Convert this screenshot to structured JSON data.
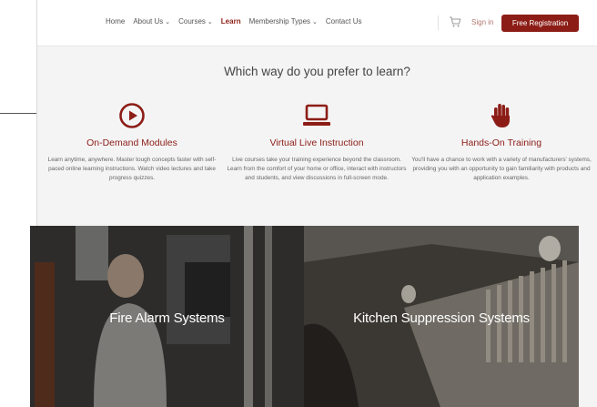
{
  "nav": {
    "links": [
      {
        "label": "Home",
        "has_dropdown": false,
        "active": false
      },
      {
        "label": "About Us",
        "has_dropdown": true,
        "active": false
      },
      {
        "label": "Courses",
        "has_dropdown": true,
        "active": false
      },
      {
        "label": "Learn",
        "has_dropdown": false,
        "active": true
      },
      {
        "label": "Membership Types",
        "has_dropdown": true,
        "active": false
      },
      {
        "label": "Contact Us",
        "has_dropdown": false,
        "active": false
      }
    ],
    "signin_label": "Sign in",
    "register_label": "Free Registration",
    "cart_icon": "cart-icon"
  },
  "main": {
    "heading": "Which way do you prefer to learn?",
    "options": [
      {
        "icon": "play-circle-icon",
        "title": "On-Demand Modules",
        "description": "Learn anytime, anywhere. Master tough concepts faster with self-paced online learning instructions. Watch video lectures and take progress quizzes."
      },
      {
        "icon": "laptop-icon",
        "title": "Virtual Live Instruction",
        "description": "Live courses take your training experience beyond the classroom. Learn from the comfort of your home or office, interact with instructors and students, and view discussions in full-screen mode."
      },
      {
        "icon": "hand-icon",
        "title": "Hands-On Training",
        "description": "You'll have a chance to work with a variety of manufacturers' systems, providing you with an opportunity to gain familiarity with products and application examples."
      }
    ],
    "categories": [
      {
        "label": "Fire Alarm Systems"
      },
      {
        "label": "Kitchen Suppression Systems"
      }
    ]
  },
  "colors": {
    "brand": "#8c1d16",
    "background": "#f4f4f5"
  }
}
